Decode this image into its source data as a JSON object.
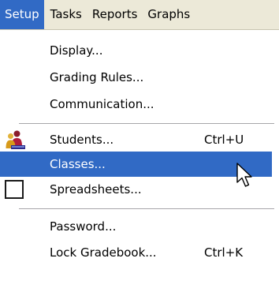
{
  "menubar": {
    "items": [
      {
        "label": "Setup",
        "active": true
      },
      {
        "label": "Tasks",
        "active": false
      },
      {
        "label": "Reports",
        "active": false
      },
      {
        "label": "Graphs",
        "active": false
      }
    ]
  },
  "setup_menu": {
    "display": {
      "label": "Display..."
    },
    "grading_rules": {
      "label": "Grading Rules..."
    },
    "communication": {
      "label": "Communication..."
    },
    "students": {
      "label": "Students...",
      "shortcut": "Ctrl+U",
      "icon": "students-icon"
    },
    "classes": {
      "label": "Classes...",
      "highlighted": true
    },
    "spreadsheets": {
      "label": "Spreadsheets...",
      "icon": "checkbox-icon"
    },
    "password": {
      "label": "Password..."
    },
    "lock_gradebook": {
      "label": "Lock Gradebook...",
      "shortcut": "Ctrl+K"
    }
  },
  "colors": {
    "highlight": "#316ac5",
    "menubar_bg": "#ece9d8",
    "menu_bg": "#ffffff",
    "separator": "#a7a6aa"
  },
  "cursor": {
    "icon": "mouse-pointer-icon"
  }
}
